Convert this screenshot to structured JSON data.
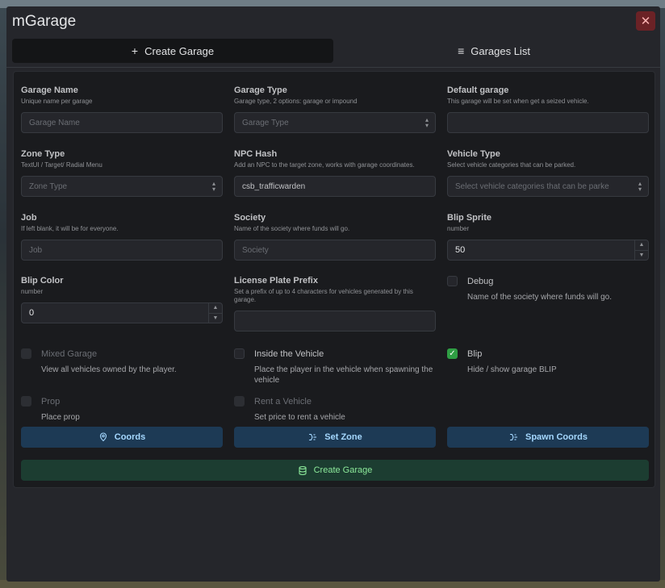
{
  "window": {
    "title": "mGarage"
  },
  "tabs": [
    {
      "label": "Create Garage",
      "icon": "plus-icon",
      "active": true
    },
    {
      "label": "Garages List",
      "icon": "list-icon",
      "active": false
    }
  ],
  "fields": {
    "garage_name": {
      "label": "Garage Name",
      "desc": "Unique name per garage",
      "placeholder": "Garage Name"
    },
    "garage_type": {
      "label": "Garage Type",
      "desc": "Garage type, 2 options: garage or impound",
      "placeholder": "Garage Type"
    },
    "default_garage": {
      "label": "Default garage",
      "desc": "This garage will be set when get a seized vehicle.",
      "value": ""
    },
    "zone_type": {
      "label": "Zone Type",
      "desc": "TextUI / Target/ Radial Menu",
      "placeholder": "Zone Type"
    },
    "npc_hash": {
      "label": "NPC Hash",
      "desc": "Add an NPC to the target zone, works with garage coordinates.",
      "value": "csb_trafficwarden"
    },
    "vehicle_type": {
      "label": "Vehicle Type",
      "desc": "Select vehicle categories that can be parked.",
      "placeholder": "Select vehicle categories that can be parke"
    },
    "job": {
      "label": "Job",
      "desc": "If left blank, it will be for everyone.",
      "placeholder": "Job"
    },
    "society": {
      "label": "Society",
      "desc": "Name of the society where funds will go.",
      "placeholder": "Society"
    },
    "blip_sprite": {
      "label": "Blip Sprite",
      "desc": "number",
      "value": "50"
    },
    "blip_color": {
      "label": "Blip Color",
      "desc": "number",
      "value": "0"
    },
    "license_prefix": {
      "label": "License Plate Prefix",
      "desc": "Set a prefix of up to 4 characters for vehicles generated by this garage.",
      "value": ""
    }
  },
  "checks": {
    "debug": {
      "label": "Debug",
      "desc": "Name of the society where funds will go.",
      "checked": false
    },
    "mixed": {
      "label": "Mixed Garage",
      "desc": "View all vehicles owned by the player.",
      "checked": false
    },
    "inside": {
      "label": "Inside the Vehicle",
      "desc": "Place the player in the vehicle when spawning the vehicle",
      "checked": false
    },
    "blip": {
      "label": "Blip",
      "desc": "Hide / show garage BLIP",
      "checked": true
    },
    "prop": {
      "label": "Prop",
      "desc": "Place prop",
      "checked": false
    },
    "rent": {
      "label": "Rent a Vehicle",
      "desc": "Set price to rent a vehicle",
      "checked": false
    }
  },
  "buttons": {
    "coords": "Coords",
    "set_zone": "Set Zone",
    "spawn_coords": "Spawn Coords",
    "create": "Create Garage"
  },
  "colors": {
    "accent_blue": "#1d3a55",
    "accent_green": "#1c3d31",
    "check_green": "#2f9e44",
    "close_red": "#6b2226"
  }
}
